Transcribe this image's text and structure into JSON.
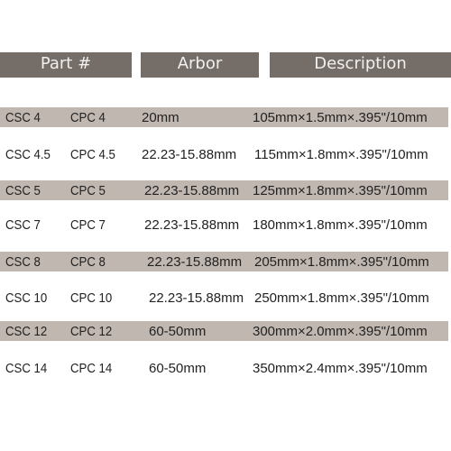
{
  "header": {
    "part": "Part #",
    "arbor": "Arbor",
    "description": "Description"
  },
  "colors": {
    "header_bg": "#746d68",
    "row_shade": "#c1b7b1"
  },
  "rows": [
    {
      "csc": "CSC 4",
      "cpc": "CPC 4",
      "arbor": "20mm",
      "description": "105mm×1.5mm×.395\"/10mm"
    },
    {
      "csc": "CSC 4.5",
      "cpc": "CPC 4.5",
      "arbor": "22.23-15.88mm",
      "description": "115mm×1.8mm×.395\"/10mm"
    },
    {
      "csc": "CSC 5",
      "cpc": "CPC 5",
      "arbor": "22.23-15.88mm",
      "description": "125mm×1.8mm×.395\"/10mm"
    },
    {
      "csc": "CSC 7",
      "cpc": "CPC 7",
      "arbor": "22.23-15.88mm",
      "description": "180mm×1.8mm×.395\"/10mm"
    },
    {
      "csc": "CSC 8",
      "cpc": "CPC 8",
      "arbor": "22.23-15.88mm",
      "description": "205mm×1.8mm×.395\"/10mm"
    },
    {
      "csc": "CSC 10",
      "cpc": "CPC 10",
      "arbor": "22.23-15.88mm",
      "description": "250mm×1.8mm×.395\"/10mm"
    },
    {
      "csc": "CSC 12",
      "cpc": "CPC 12",
      "arbor": "60-50mm",
      "description": "300mm×2.0mm×.395\"/10mm"
    },
    {
      "csc": "CSC 14",
      "cpc": "CPC 14",
      "arbor": "60-50mm",
      "description": "350mm×2.4mm×.395\"/10mm"
    }
  ]
}
